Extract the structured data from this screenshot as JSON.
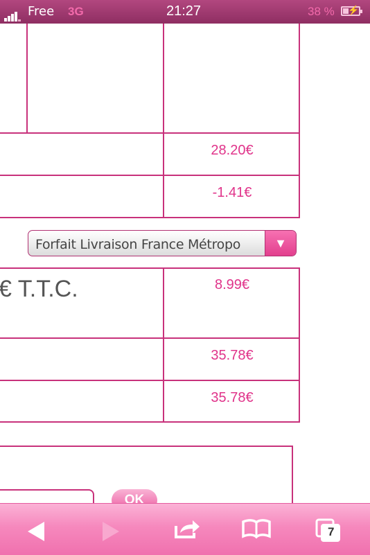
{
  "status_bar": {
    "carrier": "Free",
    "network": "3G",
    "time": "21:27",
    "battery": "38 %"
  },
  "cart": {
    "subtotal": "28.20€",
    "discount": "-1.41€",
    "shipping_select": "Forfait Livraison France Métropo",
    "ttc_label": "€ T.T.C.",
    "shipping_cost": "8.99€",
    "total": "35.78€",
    "total_ttc": "35.78€"
  },
  "coupon": {
    "ok_label": "OK"
  },
  "toolbar": {
    "tabs_count": "7"
  },
  "icons": {
    "back": "back-arrow-icon",
    "forward": "forward-arrow-icon",
    "share": "share-icon",
    "bookmarks": "book-icon",
    "tabs": "pages-icon"
  },
  "colors": {
    "accent": "#e0338a",
    "border": "#c8317b",
    "statusbar": "#9c3a6d",
    "toolbar": "#f688bd"
  }
}
